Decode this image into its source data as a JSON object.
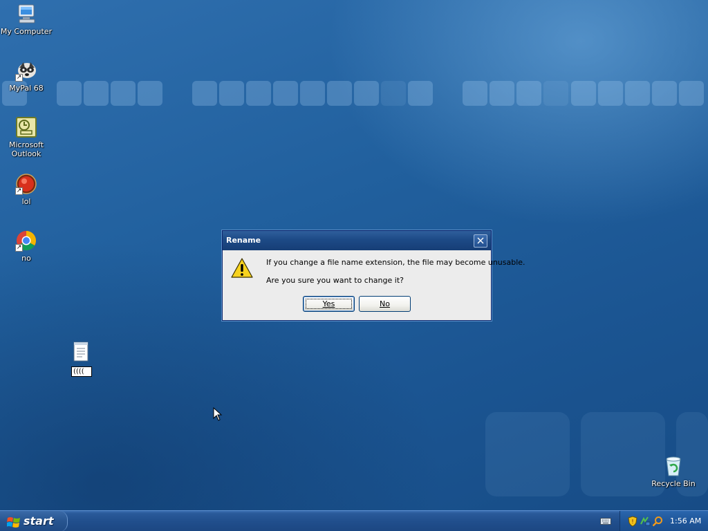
{
  "desktop": {
    "icons": [
      {
        "label": "My Computer"
      },
      {
        "label": "MyPal 68"
      },
      {
        "label": "Microsoft Outlook"
      },
      {
        "label": "lol"
      },
      {
        "label": "no"
      },
      {
        "label": "Recycle Bin"
      }
    ],
    "rename_value": "(((("
  },
  "dialog": {
    "title": "Rename",
    "message": "If you change a file name extension, the file may become unusable.",
    "question": "Are you sure you want to change it?",
    "yes_label": "Yes",
    "no_label": "No"
  },
  "taskbar": {
    "start_label": "start",
    "clock": "1:56 AM"
  },
  "colors": {
    "desktop": "#1f5c99",
    "taskbar": "#214f8d",
    "dialog_title": "#1d4a86",
    "dialog_body": "#ececec"
  },
  "icons": [
    "my-computer-icon",
    "mypal-icon",
    "outlook-icon",
    "lol-app-icon",
    "chrome-icon",
    "recycle-bin-icon",
    "text-document-icon",
    "warning-icon",
    "close-icon",
    "windows-logo-icon",
    "keyboard-icon",
    "security-shield-icon",
    "network-icon",
    "search-icon",
    "mouse-cursor-icon"
  ]
}
